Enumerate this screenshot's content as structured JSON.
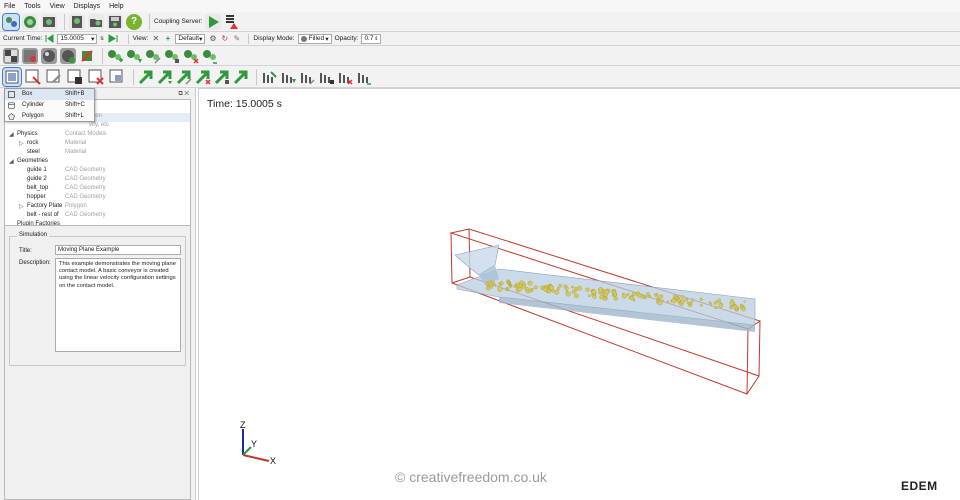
{
  "menu": [
    "File",
    "Tools",
    "View",
    "Displays",
    "Help"
  ],
  "toolbar1": {
    "coupling_label": "Coupling Server:"
  },
  "toolbar2": {
    "current_time_label": "Current Time:",
    "current_time_value": "15.0005",
    "time_unit": "s",
    "view_label": "View:",
    "view_value": "Default",
    "display_mode_label": "Display Mode:",
    "display_mode_value": "Filled",
    "opacity_label": "Opacity:",
    "opacity_value": "0.7"
  },
  "popup": {
    "items": [
      {
        "label": "Box",
        "shortcut": "Shift+B"
      },
      {
        "label": "Cylinder",
        "shortcut": "Shift+C"
      },
      {
        "label": "Polygon",
        "shortcut": "Shift+L"
      }
    ]
  },
  "tree": {
    "partial_top_1": "ation",
    "partial_top_2": "vity, etc",
    "rows": [
      {
        "name": "Physics",
        "type": "Contact Models"
      },
      {
        "name": "rock",
        "type": "Material"
      },
      {
        "name": "steel",
        "type": "Material"
      },
      {
        "name": "Geometries",
        "type": ""
      },
      {
        "name": "guide 1",
        "type": "CAD Geometry"
      },
      {
        "name": "guide 2",
        "type": "CAD Geometry"
      },
      {
        "name": "belt_top",
        "type": "CAD Geometry"
      },
      {
        "name": "hopper",
        "type": "CAD Geometry"
      },
      {
        "name": "Factory Plate",
        "type": "Polygon"
      },
      {
        "name": "belt - rest of",
        "type": "CAD Geometry"
      },
      {
        "name": "Plugin Factories",
        "type": ""
      }
    ]
  },
  "simulation": {
    "group_label": "Simulation",
    "title_label": "Title:",
    "title_value": "Moving Plane Example",
    "description_label": "Description:",
    "description_value": "This example demonstrates the moving plane contact model. A basic conveyor is created using the linear velocity configuration settings on the contact model."
  },
  "viewport": {
    "time_text": "Time: 15.0005 s",
    "axis_x": "X",
    "axis_y": "Y",
    "axis_z": "Z",
    "watermark": "© creativefreedom.co.uk",
    "logo": "EDEM"
  },
  "colors": {
    "accent_green": "#2e9a3a",
    "box_outline": "#c0392b",
    "particle": "#d6c95a",
    "conveyor": "#b9cde0"
  }
}
